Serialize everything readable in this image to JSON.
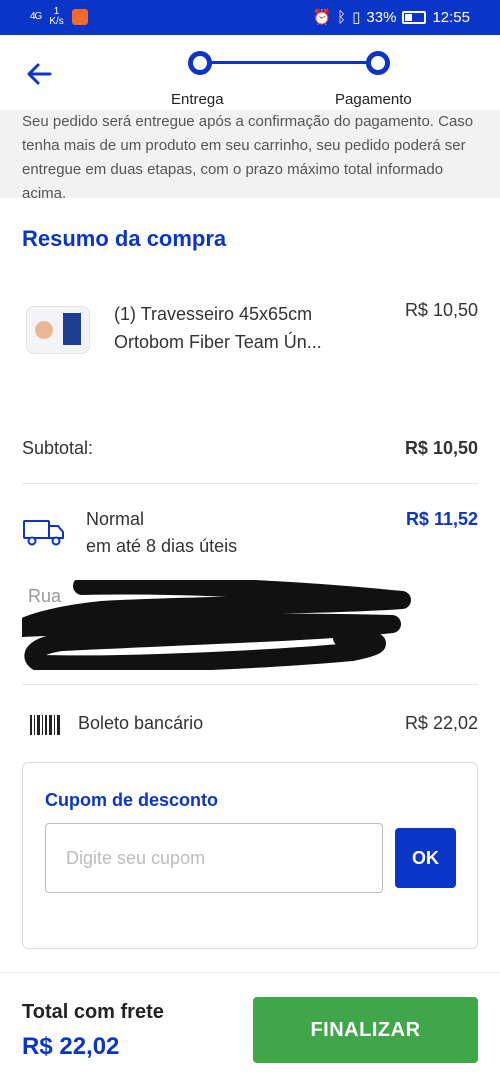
{
  "status_bar": {
    "signal": "4G",
    "speed_value": "1",
    "speed_unit": "K/s",
    "battery": "33%",
    "time": "12:55"
  },
  "header": {
    "back_icon": "arrow-left-icon",
    "steps": [
      {
        "label": "Entrega"
      },
      {
        "label": "Pagamento"
      }
    ]
  },
  "notice": {
    "text": "Seu pedido será entregue após a confirmação do pagamento. Caso tenha mais de um produto em seu carrinho, seu pedido poderá ser entregue em duas etapas, com o prazo máximo total informado acima."
  },
  "summary": {
    "title": "Resumo da compra",
    "product": {
      "line1": "(1) Travesseiro 45x65cm",
      "line2": "Ortobom Fiber Team Ún...",
      "price": "R$ 10,50"
    },
    "subtotal_label": "Subtotal:",
    "subtotal_value": "R$ 10,50"
  },
  "shipping": {
    "icon": "truck-icon",
    "name": "Normal",
    "time": "em até 8 dias úteis",
    "price": "R$ 11,52",
    "address_label": "Rua"
  },
  "payment": {
    "icon": "barcode-icon",
    "method": "Boleto bancário",
    "value": "R$ 22,02"
  },
  "coupon": {
    "title": "Cupom de desconto",
    "placeholder": "Digite seu cupom",
    "value": "",
    "ok_label": "OK"
  },
  "footer": {
    "total_label": "Total com frete",
    "total_value": "R$ 22,02",
    "finalize_label": "FINALIZAR"
  },
  "colors": {
    "brand_blue": "#0b35c6",
    "finalize_green": "#3fa64a"
  }
}
